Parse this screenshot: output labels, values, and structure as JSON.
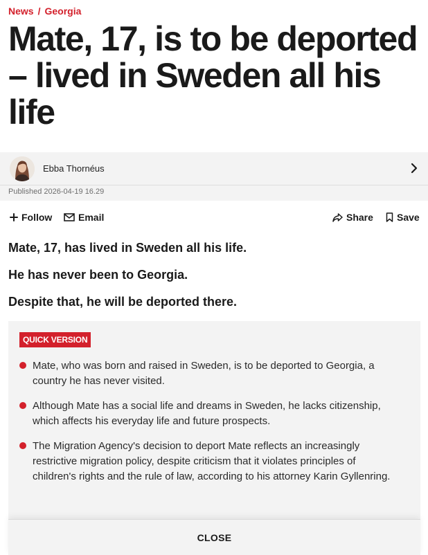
{
  "breadcrumb": {
    "section": "News",
    "separator": "/",
    "subsection": "Georgia"
  },
  "article": {
    "headline": "Mate, 17, is to be deported – lived in Sweden all his life",
    "author": "Ebba Thornéus",
    "published": "Published 2026-04-19 16.29",
    "lead": [
      "Mate, 17, has lived in Sweden all his life.",
      "He has never been to Georgia.",
      "Despite that, he will be deported there."
    ]
  },
  "actions": {
    "follow": "Follow",
    "email": "Email",
    "share": "Share",
    "save": "Save"
  },
  "quick_version": {
    "badge": "QUICK VERSION",
    "bullets": [
      "Mate, who was born and raised in Sweden, is to be deported to Georgia, a country he has never visited.",
      "Although Mate has a social life and dreams in Sweden, he lacks citizenship, which affects his everyday life and future prospects.",
      "The Migration Agency's decision to deport Mate reflects an increasingly restrictive migration policy, despite criticism that it violates principles of children's rights and the rule of law, according to his attorney Karin Gyllenring."
    ],
    "close": "CLOSE"
  },
  "colors": {
    "accent": "#d3202b",
    "panel": "#f3f3f3",
    "text": "#1a1a1a"
  }
}
